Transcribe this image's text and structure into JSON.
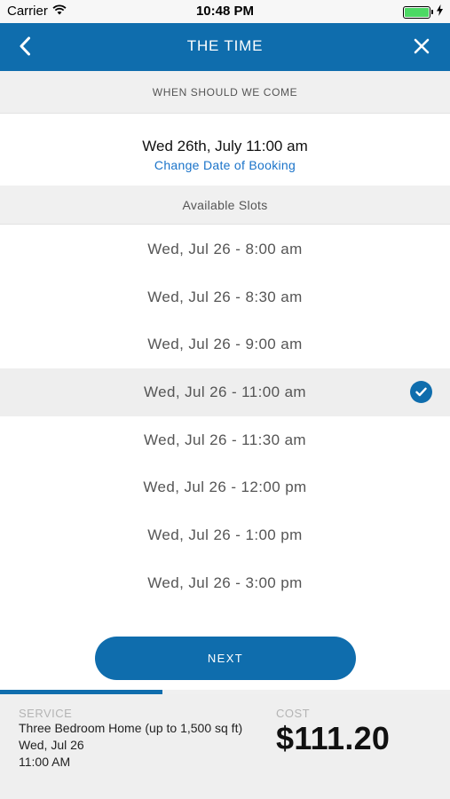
{
  "status_bar": {
    "carrier": "Carrier",
    "time": "10:48 PM",
    "battery_level": 1.0
  },
  "nav": {
    "title": "THE TIME",
    "back_icon": "chevron-left-icon",
    "close_icon": "close-icon"
  },
  "when_header": "WHEN SHOULD WE COME",
  "selected": {
    "date_text": "Wed 26th, July 11:00 am",
    "change_link": "Change Date of Booking"
  },
  "slots_header": "Available Slots",
  "slots": [
    {
      "label": "Wed, Jul 26 - 8:00 am",
      "selected": false
    },
    {
      "label": "Wed, Jul 26 - 8:30 am",
      "selected": false
    },
    {
      "label": "Wed, Jul 26 - 9:00 am",
      "selected": false
    },
    {
      "label": "Wed, Jul 26 - 11:00 am",
      "selected": true
    },
    {
      "label": "Wed, Jul 26 - 11:30 am",
      "selected": false
    },
    {
      "label": "Wed, Jul 26 - 12:00 pm",
      "selected": false
    },
    {
      "label": "Wed, Jul 26 - 1:00 pm",
      "selected": false
    },
    {
      "label": "Wed, Jul 26 - 3:00 pm",
      "selected": false
    }
  ],
  "next_button": "NEXT",
  "progress": 0.36,
  "footer": {
    "service_label": "SERVICE",
    "service_lines": [
      "Three Bedroom Home (up to 1,500 sq ft)",
      "Wed, Jul 26",
      "11:00 AM"
    ],
    "cost_label": "COST",
    "cost_value": "$111.20"
  },
  "colors": {
    "accent": "#0f6dad",
    "link": "#1a73c9",
    "selected_row": "#eeeeee"
  }
}
